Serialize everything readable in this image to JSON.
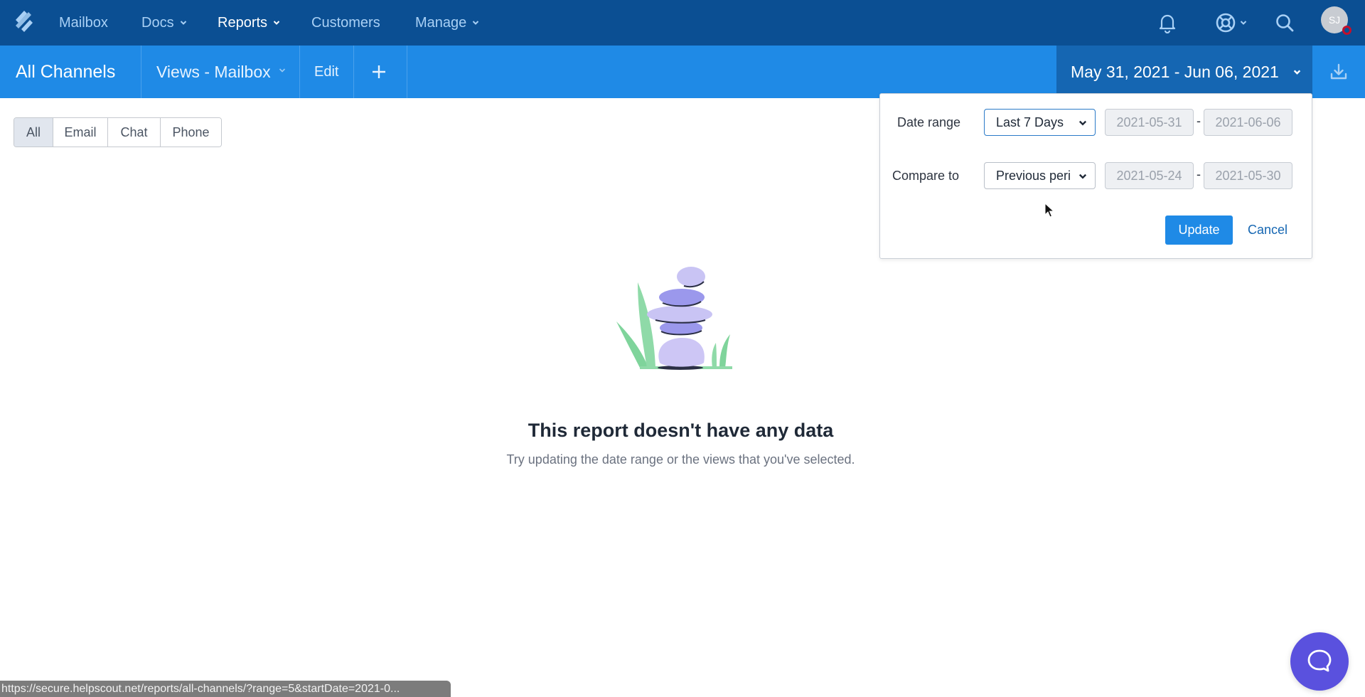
{
  "topnav": {
    "items": [
      {
        "label": "Mailbox",
        "has_dropdown": false,
        "active": false
      },
      {
        "label": "Docs",
        "has_dropdown": true,
        "active": false
      },
      {
        "label": "Reports",
        "has_dropdown": true,
        "active": true
      },
      {
        "label": "Customers",
        "has_dropdown": false,
        "active": false
      },
      {
        "label": "Manage",
        "has_dropdown": true,
        "active": false
      }
    ],
    "icons": [
      "bell-icon",
      "help-lifebuoy-icon",
      "search-icon"
    ],
    "avatar_initials": "SJ",
    "colors": {
      "background": "#0b4f93",
      "link": "#a9d0f5",
      "active": "#ffffff",
      "status_dot": "#c4102c"
    }
  },
  "subbar": {
    "title": "All Channels",
    "views_label": "Views - Mailbox",
    "edit_label": "Edit",
    "add_label": "+",
    "date_range_label": "May 31, 2021 - Jun 06, 2021",
    "colors": {
      "background": "#1f8ae6",
      "date_bg": "#1566b2"
    }
  },
  "channel_filter": {
    "options": [
      "All",
      "Email",
      "Chat",
      "Phone"
    ],
    "selected": "All"
  },
  "date_popover": {
    "date_range_label": "Date range",
    "date_range_value": "Last 7 Days",
    "start_date": "2021-05-31",
    "end_date": "2021-06-06",
    "compare_label": "Compare to",
    "compare_value": "Previous period",
    "compare_display": "Previous peri",
    "compare_start": "2021-05-24",
    "compare_end": "2021-05-30",
    "separator": "-",
    "update_label": "Update",
    "cancel_label": "Cancel"
  },
  "empty_state": {
    "title": "This report doesn't have any data",
    "subtitle": "Try updating the date range or the views that you've selected."
  },
  "status_bar": {
    "url": "https://secure.helpscout.net/reports/all-channels/?range=5&startDate=2021-0..."
  },
  "chat_beacon": {
    "icon": "chat-bubble-icon",
    "color": "#5a51de"
  }
}
